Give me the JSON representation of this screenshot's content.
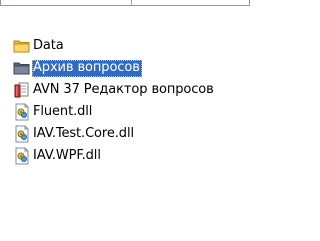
{
  "files": [
    {
      "label": "Data",
      "icon": "folder-icon",
      "selected": false
    },
    {
      "label": "Архив вопросов",
      "icon": "folder-icon",
      "selected": true
    },
    {
      "label": "AVN 37 Редактор вопросов",
      "icon": "app-exe-icon",
      "selected": false
    },
    {
      "label": "Fluent.dll",
      "icon": "dll-file-icon",
      "selected": false
    },
    {
      "label": "IAV.Test.Core.dll",
      "icon": "dll-file-icon",
      "selected": false
    },
    {
      "label": "IAV.WPF.dll",
      "icon": "dll-file-icon",
      "selected": false
    }
  ],
  "colors": {
    "selection": "#316ac5",
    "folder": "#f5d25c",
    "folder_selected": "#6f7b8e"
  }
}
